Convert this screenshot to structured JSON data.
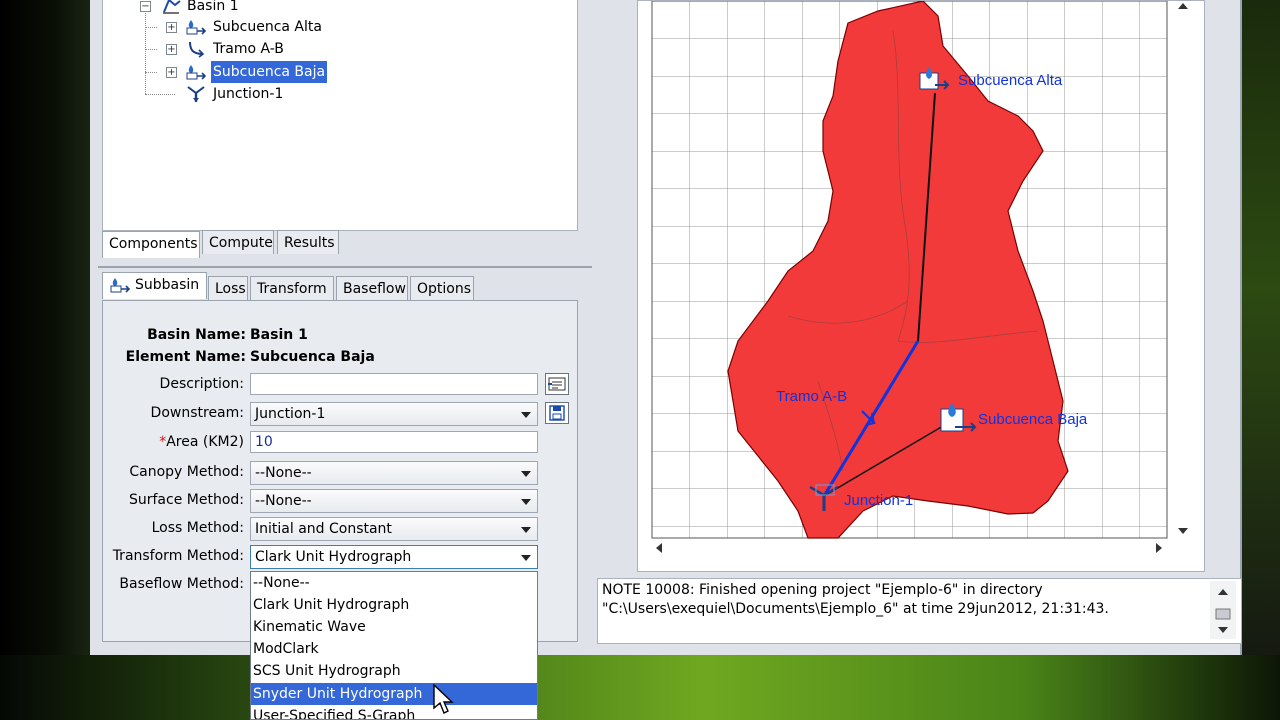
{
  "tree": {
    "items": [
      {
        "label": "Basin 1"
      },
      {
        "label": "Subcuenca Alta"
      },
      {
        "label": "Tramo A-B"
      },
      {
        "label": "Subcuenca Baja"
      },
      {
        "label": "Junction-1"
      }
    ]
  },
  "tabs": {
    "components": "Components",
    "compute": "Compute",
    "results": "Results"
  },
  "editor_tabs": {
    "subbasin": "Subbasin",
    "loss": "Loss",
    "transform": "Transform",
    "baseflow": "Baseflow",
    "options": "Options"
  },
  "form": {
    "basin_name_label": "Basin Name:",
    "basin_name_value": "Basin 1",
    "element_name_label": "Element Name:",
    "element_name_value": "Subcuenca Baja",
    "description_label": "Description:",
    "description_value": "",
    "downstream_label": "Downstream:",
    "downstream_value": "Junction-1",
    "area_required": "*",
    "area_label": "Area (KM2)",
    "area_value": "10",
    "canopy_label": "Canopy Method:",
    "canopy_value": "--None--",
    "surface_label": "Surface Method:",
    "surface_value": "--None--",
    "loss_label": "Loss Method:",
    "loss_value": "Initial and Constant",
    "transform_label": "Transform Method:",
    "transform_value": "Clark Unit Hydrograph",
    "baseflow_label": "Baseflow Method:"
  },
  "transform_options": [
    "--None--",
    "Clark Unit Hydrograph",
    "Kinematic Wave",
    "ModClark",
    "SCS Unit Hydrograph",
    "Snyder Unit Hydrograph",
    "User-Specified S-Graph"
  ],
  "transform_highlighted": "Snyder Unit Hydrograph",
  "map": {
    "labels": {
      "subcuenca_alta": "Subcuenca Alta",
      "tramo": "Tramo A-B",
      "subcuenca_baja": "Subcuenca Baja",
      "junction": "Junction-1"
    },
    "basin_fill": "#f33a3a",
    "element_link_color": "#1133dd"
  },
  "messages": {
    "line1": "NOTE 10008:  Finished opening project \"Ejemplo-6\" in directory",
    "line2": "\"C:\\Users\\exequiel\\Documents\\Ejemplo_6\" at time 29jun2012, 21:31:43."
  }
}
